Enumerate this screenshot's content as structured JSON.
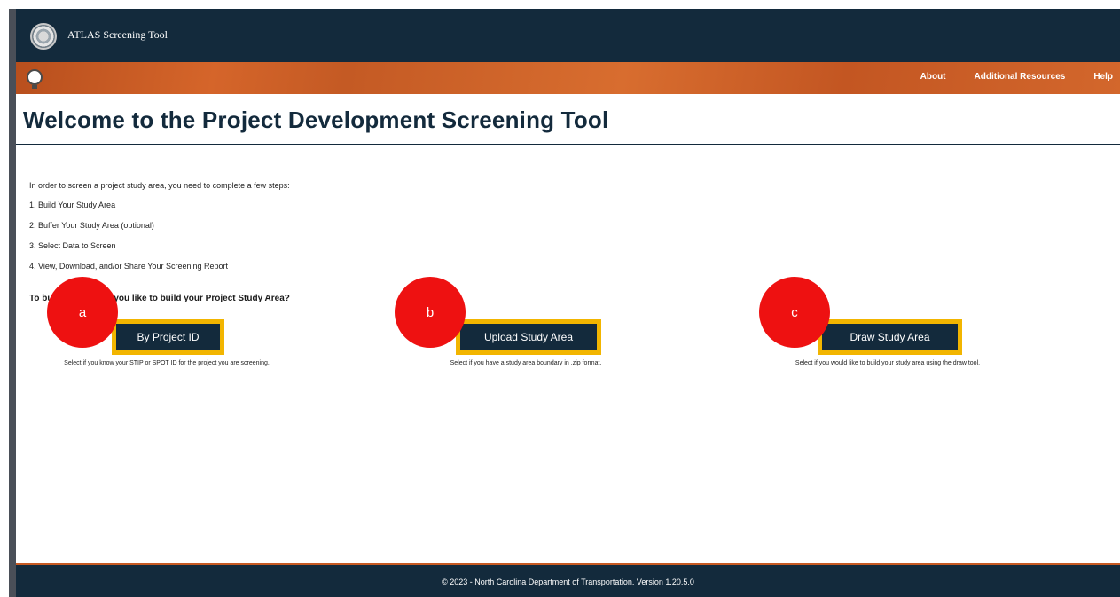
{
  "header": {
    "app_title": "ATLAS Screening Tool"
  },
  "nav": {
    "items": [
      "About",
      "Additional Resources",
      "Help"
    ]
  },
  "page": {
    "title": "Welcome to the Project Development Screening Tool",
    "intro": "In order to screen a project study area, you need to complete a few steps:",
    "steps": [
      "1. Build Your Study Area",
      "2. Buffer Your Study Area (optional)",
      "3. Select Data to Screen",
      "4. View, Download, and/or Share Your Screening Report"
    ],
    "question": "To build how would you like to build your Project Study Area?"
  },
  "options": [
    {
      "marker": "a",
      "label": "By Project ID",
      "description": "Select if you know your STIP or SPOT ID for the project you are screening."
    },
    {
      "marker": "b",
      "label": "Upload Study Area",
      "description": "Select if you have a study area boundary in .zip format."
    },
    {
      "marker": "c",
      "label": "Draw Study Area",
      "description": "Select if you would like to build your study area using the draw tool."
    }
  ],
  "footer": {
    "text": "© 2023 - North Carolina Department of Transportation. Version 1.20.5.0"
  },
  "colors": {
    "navy": "#132a3c",
    "orange": "#d5652a",
    "highlight": "#f2b500",
    "marker": "#ee1111"
  },
  "icons": {
    "seal": "ncdot-seal-icon",
    "globe": "globe-icon"
  }
}
